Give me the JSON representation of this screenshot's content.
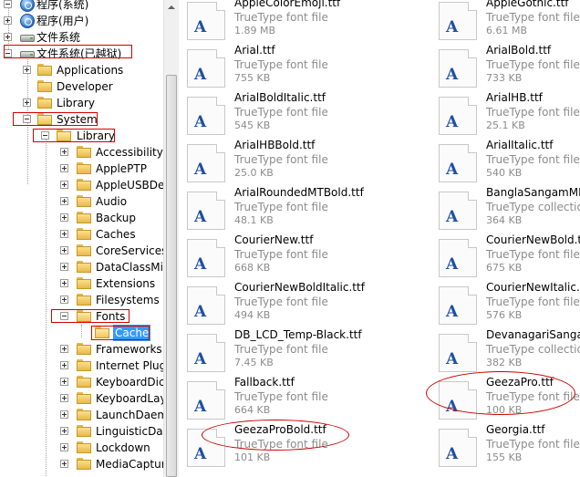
{
  "tree": {
    "items": [
      {
        "label": "程序(系统)",
        "icon": "app-icon"
      },
      {
        "label": "程序(用户)",
        "icon": "app-icon"
      },
      {
        "label": "文件系统",
        "icon": "drive-icon"
      },
      {
        "label": "文件系统(已越狱)",
        "icon": "drive-icon"
      },
      {
        "label": "Applications",
        "icon": "folder-icon"
      },
      {
        "label": "Developer",
        "icon": "folder-icon"
      },
      {
        "label": "Library",
        "icon": "folder-icon"
      },
      {
        "label": "System",
        "icon": "folder-icon"
      },
      {
        "label": "Library",
        "icon": "folder-icon"
      },
      {
        "label": "AccessibilityBu",
        "icon": "folder-icon"
      },
      {
        "label": "ApplePTP",
        "icon": "folder-icon"
      },
      {
        "label": "AppleUSBDevi",
        "icon": "folder-icon"
      },
      {
        "label": "Audio",
        "icon": "folder-icon"
      },
      {
        "label": "Backup",
        "icon": "folder-icon"
      },
      {
        "label": "Caches",
        "icon": "folder-icon"
      },
      {
        "label": "CoreServices",
        "icon": "folder-icon"
      },
      {
        "label": "DataClassMigr",
        "icon": "folder-icon"
      },
      {
        "label": "Extensions",
        "icon": "folder-icon"
      },
      {
        "label": "Filesystems",
        "icon": "folder-icon"
      },
      {
        "label": "Fonts",
        "icon": "folder-icon"
      },
      {
        "label": "Cache",
        "icon": "folder-icon"
      },
      {
        "label": "Frameworks",
        "icon": "folder-icon"
      },
      {
        "label": "Internet Plug-",
        "icon": "folder-icon"
      },
      {
        "label": "KeyboardDicti",
        "icon": "folder-icon"
      },
      {
        "label": "KeyboardLayo",
        "icon": "folder-icon"
      },
      {
        "label": "LaunchDaemo",
        "icon": "folder-icon"
      },
      {
        "label": "LinguisticData",
        "icon": "folder-icon"
      },
      {
        "label": "Lockdown",
        "icon": "folder-icon"
      },
      {
        "label": "MediaCapture",
        "icon": "folder-icon"
      }
    ]
  },
  "files": [
    {
      "name": "AppleColorEmoji.ttf",
      "type": "TrueType font file",
      "size": "1.89 MB",
      "icon": "font-file-icon"
    },
    {
      "name": "AppleGothic.ttf",
      "type": "TrueType font file",
      "size": "6.61 MB",
      "icon": "font-file-icon"
    },
    {
      "name": "Arial.ttf",
      "type": "TrueType font file",
      "size": "755 KB",
      "icon": "font-file-icon"
    },
    {
      "name": "ArialBold.ttf",
      "type": "TrueType font file",
      "size": "733 KB",
      "icon": "font-file-icon"
    },
    {
      "name": "ArialBoldItalic.ttf",
      "type": "TrueType font file",
      "size": "545 KB",
      "icon": "font-file-icon"
    },
    {
      "name": "ArialHB.ttf",
      "type": "TrueType font file",
      "size": "25.1 KB",
      "icon": "font-file-icon"
    },
    {
      "name": "ArialHBBold.ttf",
      "type": "TrueType font file",
      "size": "25.0 KB",
      "icon": "font-file-icon"
    },
    {
      "name": "ArialItalic.ttf",
      "type": "TrueType font file",
      "size": "540 KB",
      "icon": "font-file-icon"
    },
    {
      "name": "ArialRoundedMTBold.ttf",
      "type": "TrueType font file",
      "size": "48.1 KB",
      "icon": "font-file-icon"
    },
    {
      "name": "BanglaSangamMN.t",
      "type": "TrueType collection",
      "size": "364 KB",
      "icon": "font-file-icon"
    },
    {
      "name": "CourierNew.ttf",
      "type": "TrueType font file",
      "size": "668 KB",
      "icon": "font-file-icon"
    },
    {
      "name": "CourierNewBold.ttf",
      "type": "TrueType font file",
      "size": "675 KB",
      "icon": "font-file-icon"
    },
    {
      "name": "CourierNewBoldItalic.ttf",
      "type": "TrueType font file",
      "size": "494 KB",
      "icon": "font-file-icon"
    },
    {
      "name": "CourierNewItalic.ttf",
      "type": "TrueType font file",
      "size": "576 KB",
      "icon": "font-file-icon"
    },
    {
      "name": "DB_LCD_Temp-Black.ttf",
      "type": "TrueType font file",
      "size": "7.45 KB",
      "icon": "font-file-icon"
    },
    {
      "name": "DevanagariSangam",
      "type": "TrueType collection",
      "size": "382 KB",
      "icon": "font-file-icon"
    },
    {
      "name": "Fallback.ttf",
      "type": "TrueType font file",
      "size": "664 KB",
      "icon": "font-file-icon"
    },
    {
      "name": "GeezaPro.ttf",
      "type": "TrueType font file",
      "size": "100 KB",
      "icon": "font-file-icon"
    },
    {
      "name": "GeezaProBold.ttf",
      "type": "TrueType font file",
      "size": "101 KB",
      "icon": "font-file-icon"
    },
    {
      "name": "Georgia.ttf",
      "type": "TrueType font file",
      "size": "155 KB",
      "icon": "font-file-icon"
    }
  ],
  "file_icon_glyph": "A",
  "colors": {
    "highlight_red": "#d40000",
    "selection_blue": "#3399ff",
    "secondary_text": "#8c8c8c",
    "font_glyph_blue": "#1f4fa3"
  }
}
